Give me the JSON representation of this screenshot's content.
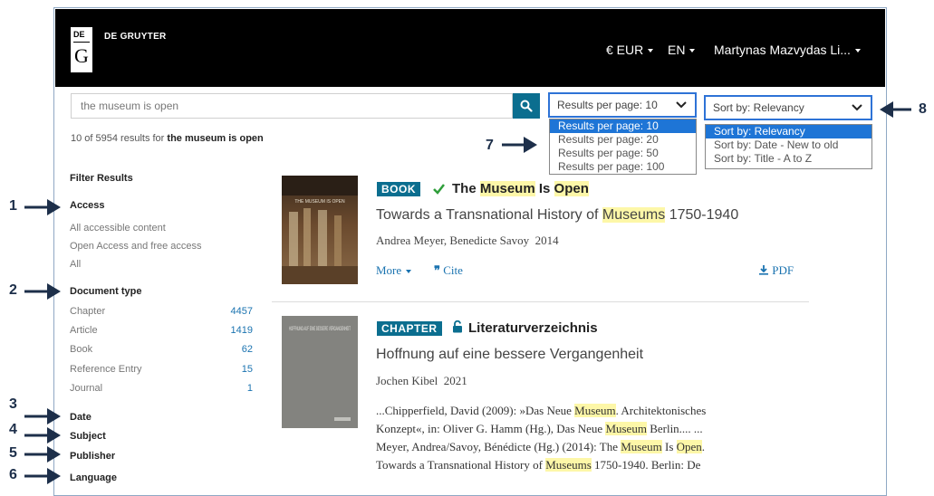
{
  "header": {
    "logo_top": "DE",
    "logo_bottom": "G",
    "brand": "DE GRUYTER",
    "currency": "€ EUR",
    "language": "EN",
    "user": "Martynas Mazvydas Li..."
  },
  "search": {
    "query": "the museum is open",
    "results_prefix": "10 of 5954 results for",
    "results_query": "the museum is open"
  },
  "results_per_page": {
    "selected": "Results per page: 10",
    "options": [
      "Results per page: 10",
      "Results per page: 20",
      "Results per page: 50",
      "Results per page: 100"
    ]
  },
  "sort": {
    "selected": "Sort by: Relevancy",
    "options": [
      "Sort by: Relevancy",
      "Sort by: Date - New to old",
      "Sort by: Title - A to Z"
    ]
  },
  "annotations": [
    "1",
    "2",
    "3",
    "4",
    "5",
    "6",
    "7",
    "8"
  ],
  "filters": {
    "title": "Filter Results",
    "access": {
      "heading": "Access",
      "items": [
        "All accessible content",
        "Open Access and free access",
        "All"
      ]
    },
    "document_type": {
      "heading": "Document type",
      "items": [
        {
          "label": "Chapter",
          "count": "4457"
        },
        {
          "label": "Article",
          "count": "1419"
        },
        {
          "label": "Book",
          "count": "62"
        },
        {
          "label": "Reference Entry",
          "count": "15"
        },
        {
          "label": "Journal",
          "count": "1"
        }
      ]
    },
    "date": "Date",
    "subject": "Subject",
    "publisher": "Publisher",
    "language": "Language"
  },
  "results": [
    {
      "badge": "BOOK",
      "title_parts": [
        "The ",
        "Museum",
        " Is ",
        "Open"
      ],
      "subtitle_parts": [
        "Towards a Transnational History of ",
        "Museums",
        " 1750-1940"
      ],
      "authors": "Andrea Meyer, Benedicte Savoy",
      "year": "2014",
      "more": "More",
      "cite": "Cite",
      "pdf": "PDF",
      "cover_text": "THE MUSEUM IS OPEN"
    },
    {
      "badge": "CHAPTER",
      "title": "Literaturverzeichnis",
      "subtitle": "Hoffnung auf eine bessere Vergangenheit",
      "authors": "Jochen Kibel",
      "year": "2021",
      "cover_text": "HOFFNUNG AUF EINE BESSERE VERGANGENHEIT",
      "excerpt": {
        "l1": [
          "...Chipperfield, David (2009): »Das Neue ",
          "Museum",
          ". Architektonisches"
        ],
        "l2": [
          "Konzept«, in: Oliver G. Hamm (Hg.), Das Neue ",
          "Museum",
          " Berlin.... ..."
        ],
        "l3": [
          "Meyer, Andrea/Savoy, Bénédicte (Hg.) (2014): The ",
          "Museum",
          " Is ",
          "Open",
          "."
        ],
        "l4": [
          "Towards a Transnational History of ",
          "Museums",
          " 1750-1940. Berlin: De"
        ]
      }
    }
  ],
  "colors": {
    "header_bg": "#000000",
    "accent": "#0b6e8f",
    "link": "#1a73b0",
    "highlight": "#fdf7a8",
    "select_border": "#2e73d6",
    "option_selected": "#1e75d6",
    "arrow": "#1d2f4a"
  }
}
